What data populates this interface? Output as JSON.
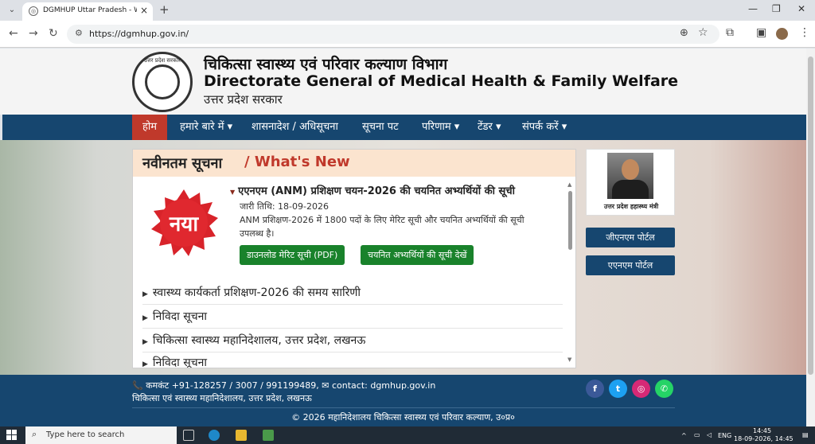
{
  "browser": {
    "tab_title": "DGMHUP Uttar Pradesh - Welc",
    "url": "https://dgmhup.gov.in/"
  },
  "site": {
    "title_hi": "चिकित्सा स्वास्थ्य एवं परिवार कल्याण विभाग",
    "title_en": "Directorate General of Medical Health & Family Welfare",
    "state": "उत्तर प्रदेश सरकार",
    "emblem_text": "उत्तर प्रदेश सरकार"
  },
  "nav": {
    "items": [
      "होम",
      "हमारे बारे में ▾",
      "शासनादेश / अधिसूचना",
      "सूचना पट",
      "परिणाम ▾",
      "टेंडर ▾",
      "संपर्क करें ▾"
    ]
  },
  "whats_new": {
    "heading_hi": "नवीनतम सूचना",
    "heading_en": "/ What's New",
    "badge": "नया",
    "news_title": "एएनएम (ANM) प्रशिक्षण चयन-2026 की चयनित अभ्यर्थियों की सूची",
    "news_date": "जारी तिथि: 18-09-2026",
    "news_desc": "ANM प्रशिक्षण-2026 में 1800 पदों के लिए मेरिट सूची और चयनित अभ्यर्थियों की सूची उपलब्ध है।",
    "btn_download": "डाउनलोड मेरिट सूची (PDF)",
    "btn_view": "चयनित अभ्यर्थियों की सूची देखें",
    "list": [
      "स्वास्थ्य कार्यकर्ता प्रशिक्षण-2026 की समय सारिणी",
      "निविदा सूचना",
      "चिकित्सा स्वास्थ्य महानिदेशालय, उत्तर प्रदेश, लखनऊ",
      "निविदा सूचना"
    ]
  },
  "sidebar": {
    "minister_label": "उत्तर प्रदेश हहास्थ्य मंत्री",
    "portal1": "जीएनएम पोर्टल",
    "portal2": "एएनएम पोर्टल"
  },
  "footer": {
    "contact": "📞 कमकंट +91-128257 / 3007 / 991199489, ✉ contact: dgmhup.gov.in",
    "dept": "चिकित्सा एवं स्वास्थ्य महानिदेशालय, उत्तर प्रदेश, लखनऊ",
    "copyright": "© 2026 महानिदेशालय चिकित्सा स्वास्थ्य एवं परिवार कल्याण, उ०प्र०"
  },
  "taskbar": {
    "search_placeholder": "Type here to search",
    "language": "ENG",
    "time": "14:45",
    "date": "18-09-2026, 14:45"
  },
  "colors": {
    "nav_blue": "#16466f",
    "accent_red": "#c0392b",
    "button_green": "#19822b",
    "panel_header": "#fbe4cf"
  }
}
